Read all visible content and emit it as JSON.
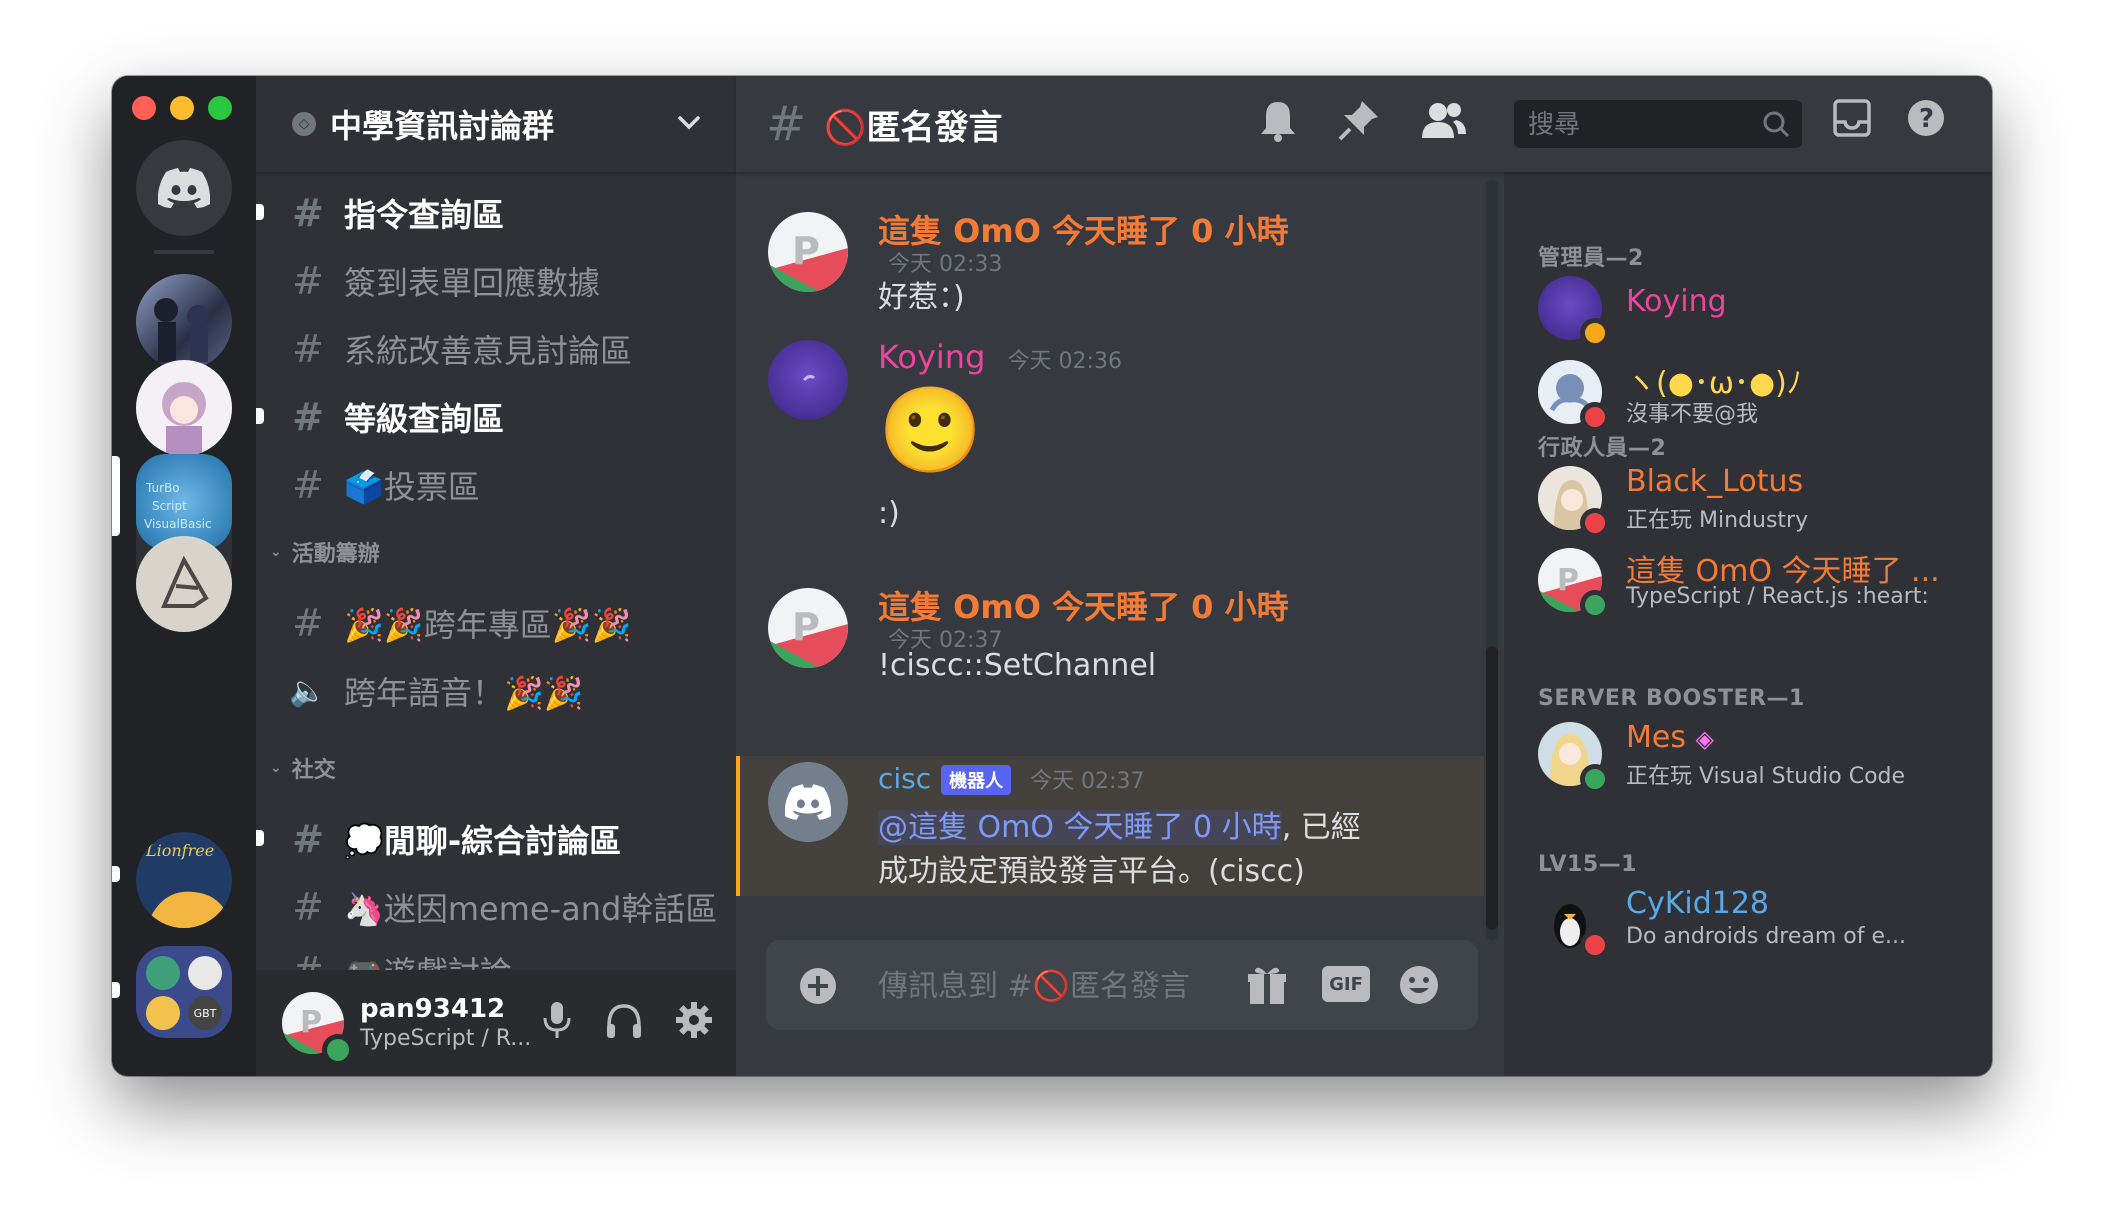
{
  "server": {
    "name": "中學資訊討論群"
  },
  "channels": [
    {
      "name": "指令查詢區",
      "unread": true
    },
    {
      "name": "簽到表單回應數據",
      "unread": false
    },
    {
      "name": "系統改善意見討論區",
      "unread": false
    },
    {
      "name": "等級查詢區",
      "unread": true
    },
    {
      "name": "🗳️投票區",
      "unread": false
    }
  ],
  "categories": {
    "events": {
      "label": "活動籌辦",
      "channels": [
        "🎉🎉跨年專區🎉🎉",
        "跨年語音！🎉🎉"
      ]
    },
    "social": {
      "label": "社交",
      "channels": [
        "💭閒聊-綜合討論區",
        "🦄迷因meme-and幹話區",
        "🎮遊戲討論"
      ]
    }
  },
  "user_panel": {
    "username": "pan93412",
    "status": "TypeScript / R..."
  },
  "chat": {
    "channel_name": "🚫匿名發言",
    "search_placeholder": "搜尋",
    "composer_placeholder": "傳訊息到 #🚫匿名發言",
    "gif_label": "GIF",
    "messages": [
      {
        "author": "這隻 OmO 今天睡了 0 小時",
        "timestamp": "今天 02:33",
        "text": "好惹：)"
      },
      {
        "author": "Koying",
        "timestamp": "今天 02:36",
        "emoji": "🙂",
        "text": ":)"
      },
      {
        "author": "這隻 OmO 今天睡了 0 小時",
        "timestamp": "今天 02:37",
        "text": "!ciscc::SetChannel"
      },
      {
        "author": "cisc",
        "bot_tag": "機器人",
        "timestamp": "今天 02:37",
        "mention": "@這隻 OmO 今天睡了 0 小時",
        "text_line1": ", 已經",
        "text_line2": "成功設定預設發言平台。(ciscc)"
      }
    ]
  },
  "members": {
    "groups": [
      {
        "label": "管理員—2",
        "members": [
          {
            "name": "Koying",
            "activity": ""
          },
          {
            "name": "ヽ(●･ω･●)ﾉ",
            "activity": "沒事不要@我"
          }
        ]
      },
      {
        "label": "行政人員—2",
        "members": [
          {
            "name": "Black_Lotus",
            "activity": "正在玩 Mindustry"
          },
          {
            "name": "這隻 OmO 今天睡了 ...",
            "activity": "TypeScript / React.js :heart:"
          }
        ]
      },
      {
        "label": "SERVER BOOSTER—1",
        "members": [
          {
            "name": "Mes",
            "activity": "正在玩 Visual Studio Code"
          }
        ]
      },
      {
        "label": "LV15—1",
        "members": [
          {
            "name": "CyKid128",
            "activity": "Do androids dream of e..."
          }
        ]
      }
    ]
  },
  "colors": {
    "orange_role": "#f47b36",
    "pink_role": "#eb459e",
    "blue_role": "#5aa9e6",
    "online": "#3ba55d",
    "dnd": "#ed4245",
    "idle": "#faa81a"
  }
}
